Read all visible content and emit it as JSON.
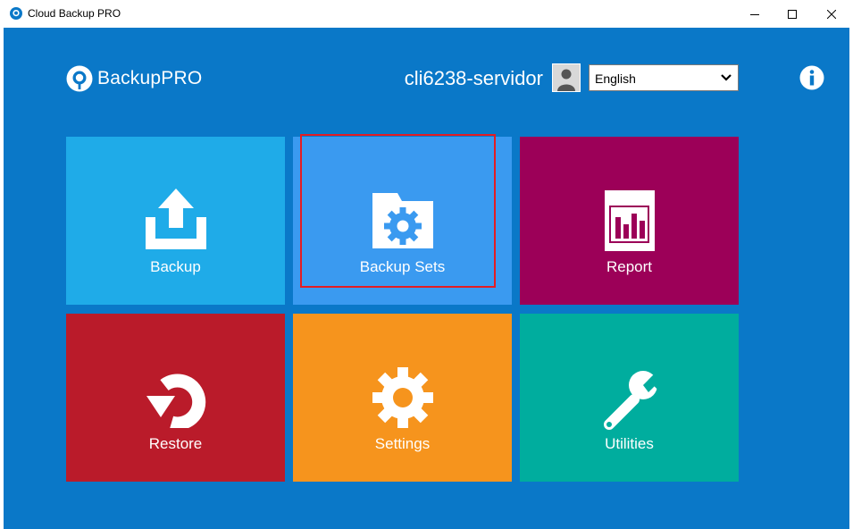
{
  "window": {
    "title": "Cloud Backup PRO",
    "controls": [
      "minimize",
      "maximize",
      "close"
    ]
  },
  "header": {
    "logo_text": "BackupPRO",
    "username": "cli6238-servidor",
    "language": {
      "selected": "English"
    },
    "info_icon": "info-icon"
  },
  "colors": {
    "background": "#0a78c8",
    "backup": "#1fabe8",
    "backup_sets": "#3a9af0",
    "report": "#9c0058",
    "restore": "#ba1b2a",
    "settings": "#f6941d",
    "utilities": "#00ad9e",
    "highlight": "#e41c23"
  },
  "tiles": [
    {
      "label": "Backup",
      "icon": "upload-icon"
    },
    {
      "label": "Backup Sets",
      "icon": "folder-gear-icon"
    },
    {
      "label": "Report",
      "icon": "bar-chart-icon"
    },
    {
      "label": "Restore",
      "icon": "restore-arrow-icon"
    },
    {
      "label": "Settings",
      "icon": "gear-icon"
    },
    {
      "label": "Utilities",
      "icon": "wrench-icon"
    }
  ]
}
